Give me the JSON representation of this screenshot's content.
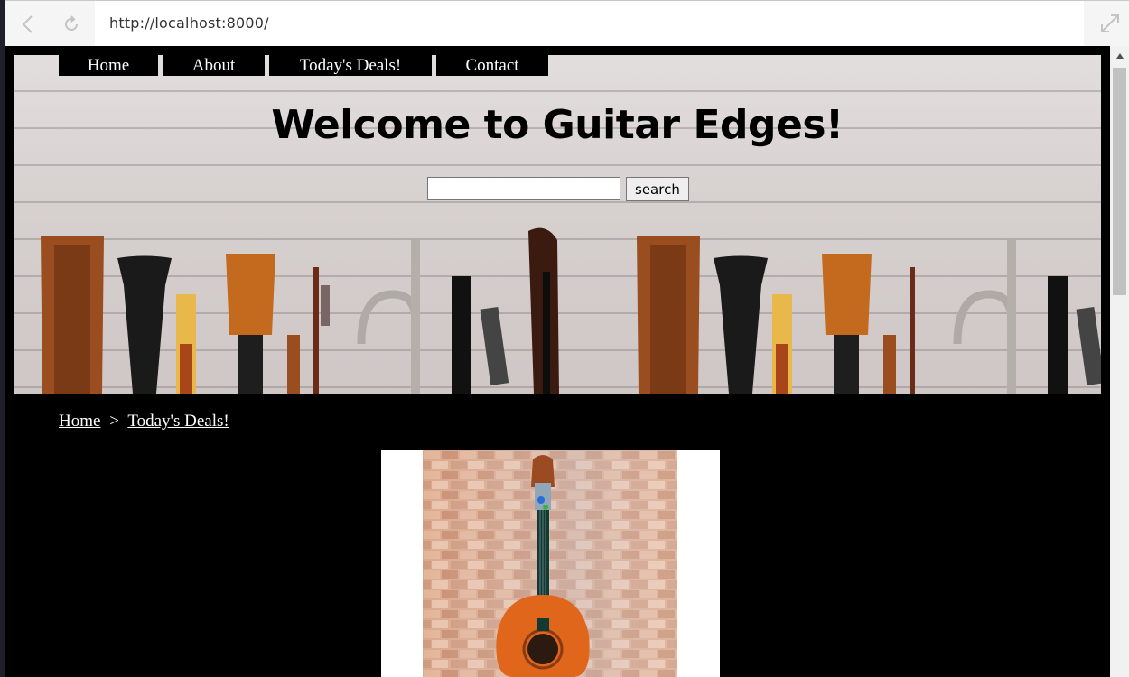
{
  "browser": {
    "url": "http://localhost:8000/"
  },
  "nav": {
    "items": [
      {
        "label": "Home"
      },
      {
        "label": "About"
      },
      {
        "label": "Today's Deals!"
      },
      {
        "label": "Contact"
      }
    ]
  },
  "header": {
    "title": "Welcome to Guitar Edges!",
    "search": {
      "value": "",
      "button_label": "search"
    }
  },
  "breadcrumb": {
    "home": "Home",
    "separator": ">",
    "current": "Today's Deals!"
  },
  "colors": {
    "page_background": "#000000",
    "banner_wood": "#d6d0cf",
    "link_text": "#ffffff"
  },
  "icons": [
    "back-arrow-icon",
    "reload-icon",
    "expand-icon",
    "scroll-up-arrow-icon"
  ]
}
